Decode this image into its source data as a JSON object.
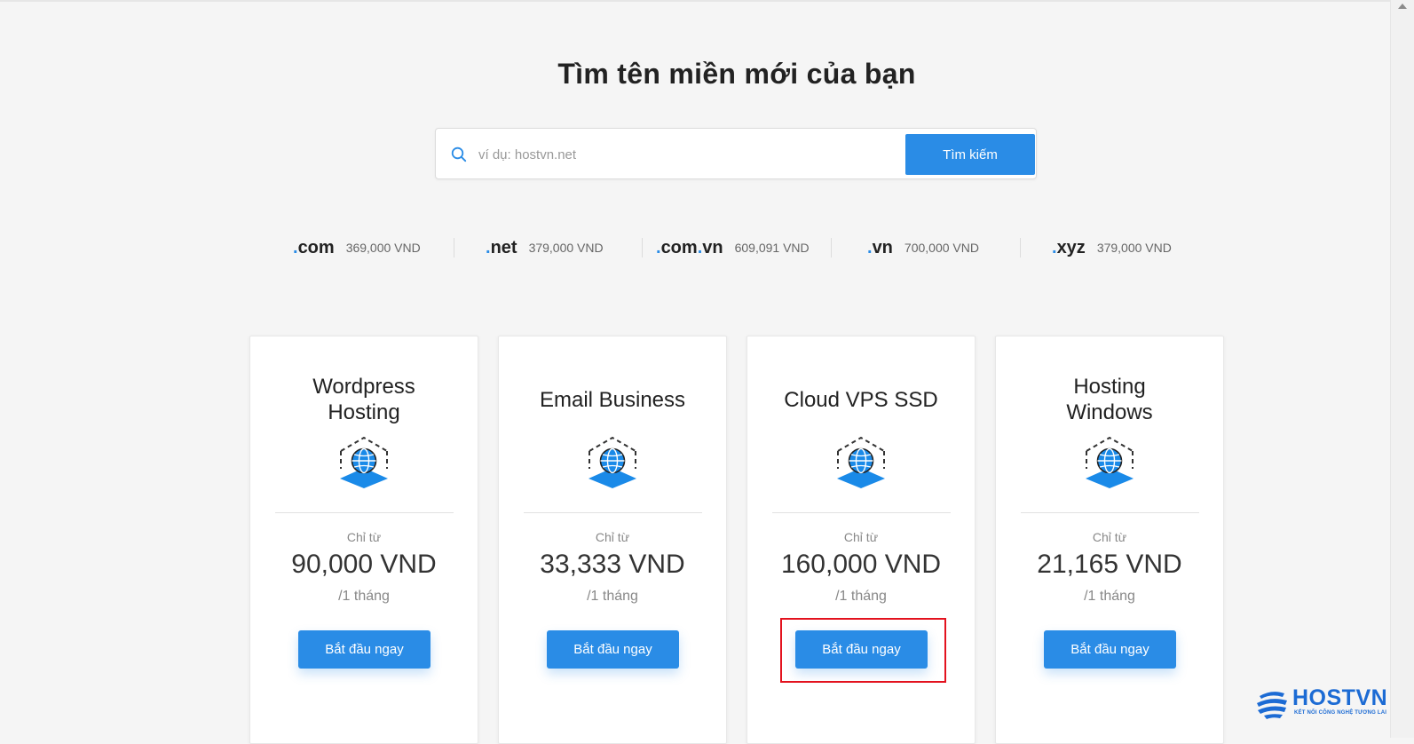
{
  "page": {
    "title": "Tìm tên miền mới của bạn"
  },
  "search": {
    "placeholder": "ví dụ: hostvn.net",
    "button_label": "Tìm kiếm",
    "icon": "search-icon"
  },
  "tlds": [
    {
      "name": ".com",
      "price": "369,000 VND"
    },
    {
      "name": ".net",
      "price": "379,000 VND"
    },
    {
      "name": ".com.vn",
      "price": "609,091 VND"
    },
    {
      "name": ".vn",
      "price": "700,000 VND"
    },
    {
      "name": ".xyz",
      "price": "379,000 VND"
    }
  ],
  "plans": [
    {
      "title": "Wordpress Hosting",
      "from_label": "Chỉ từ",
      "price": "90,000 VND",
      "period": "/1 tháng",
      "button_label": "Bắt đầu ngay",
      "icon": "globe-network-icon"
    },
    {
      "title": "Email Business",
      "from_label": "Chỉ từ",
      "price": "33,333 VND",
      "period": "/1 tháng",
      "button_label": "Bắt đầu ngay",
      "icon": "globe-network-icon"
    },
    {
      "title": "Cloud VPS SSD",
      "from_label": "Chỉ từ",
      "price": "160,000 VND",
      "period": "/1 tháng",
      "button_label": "Bắt đầu ngay",
      "icon": "globe-network-icon",
      "highlighted": true
    },
    {
      "title": "Hosting Windows",
      "from_label": "Chỉ từ",
      "price": "21,165 VND",
      "period": "/1 tháng",
      "button_label": "Bắt đầu ngay",
      "icon": "globe-network-icon"
    }
  ],
  "brand": {
    "name": "HOSTVN",
    "tagline": "KẾT NỐI CÔNG NGHỆ TƯƠNG LAI"
  },
  "colors": {
    "accent": "#2a8ce6",
    "highlight": "#e3121e",
    "brand": "#1c6bd4",
    "background": "#f5f5f5"
  }
}
